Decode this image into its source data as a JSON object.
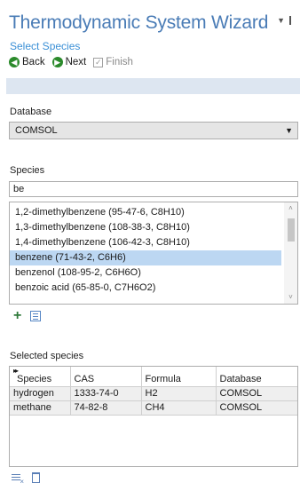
{
  "header": {
    "title": "Thermodynamic System Wizard",
    "subtitle": "Select Species"
  },
  "toolbar": {
    "back_label": "Back",
    "next_label": "Next",
    "finish_label": "Finish"
  },
  "database": {
    "label": "Database",
    "selected": "COMSOL"
  },
  "species": {
    "label": "Species",
    "search_value": "be",
    "items": [
      "1,2-dimethylbenzene (95-47-6, C8H10)",
      "1,3-dimethylbenzene (108-38-3, C8H10)",
      "1,4-dimethylbenzene (106-42-3, C8H10)",
      "benzene (71-43-2, C6H6)",
      "benzenol (108-95-2, C6H6O)",
      "benzoic acid (65-85-0, C7H6O2)"
    ],
    "selected_index": 3
  },
  "selected_species": {
    "label": "Selected species",
    "columns": [
      "Species",
      "CAS",
      "Formula",
      "Database"
    ],
    "rows": [
      [
        "hydrogen",
        "1333-74-0",
        "H2",
        "COMSOL"
      ],
      [
        "methane",
        "74-82-8",
        "CH4",
        "COMSOL"
      ]
    ]
  },
  "icons": {
    "back": "back-arrow-icon",
    "next": "next-arrow-icon",
    "finish": "checkbox-icon",
    "add": "plus-icon",
    "browse": "species-browse-icon",
    "clear": "clear-table-icon",
    "delete": "trash-icon"
  },
  "colors": {
    "title": "#4a7cb6",
    "subtitle": "#3a8fd6",
    "nav_button": "#2b8a2b",
    "selection": "#bcd7f2",
    "band": "#dde6f1"
  }
}
